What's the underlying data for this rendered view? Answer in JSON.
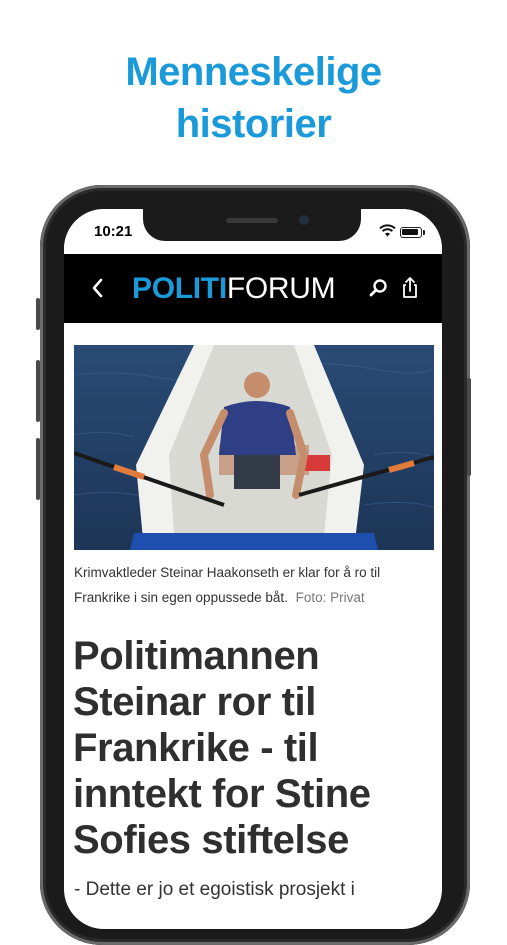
{
  "promo": {
    "headline_line1": "Menneskelige",
    "headline_line2": "historier"
  },
  "status_bar": {
    "time": "10:21"
  },
  "app_bar": {
    "logo_part1": "POLITI",
    "logo_part2": "FORUM",
    "back_icon": "chevron-left-icon",
    "search_icon": "search-icon",
    "share_icon": "share-icon"
  },
  "article": {
    "image_description_icon": "article-photo",
    "caption": "Krimvaktleder Steinar Haakonseth er klar for å ro til Frankrike i sin egen oppussede båt.",
    "credit": "Foto: Privat",
    "title": "Politimannen Steinar ror til Frankrike - til inntekt for Stine Sofies stiftelse",
    "lead": "- Dette er jo et egoistisk prosjekt i"
  },
  "colors": {
    "accent": "#1a9ad9",
    "navbar": "#000000",
    "title": "#2f2f2f"
  }
}
